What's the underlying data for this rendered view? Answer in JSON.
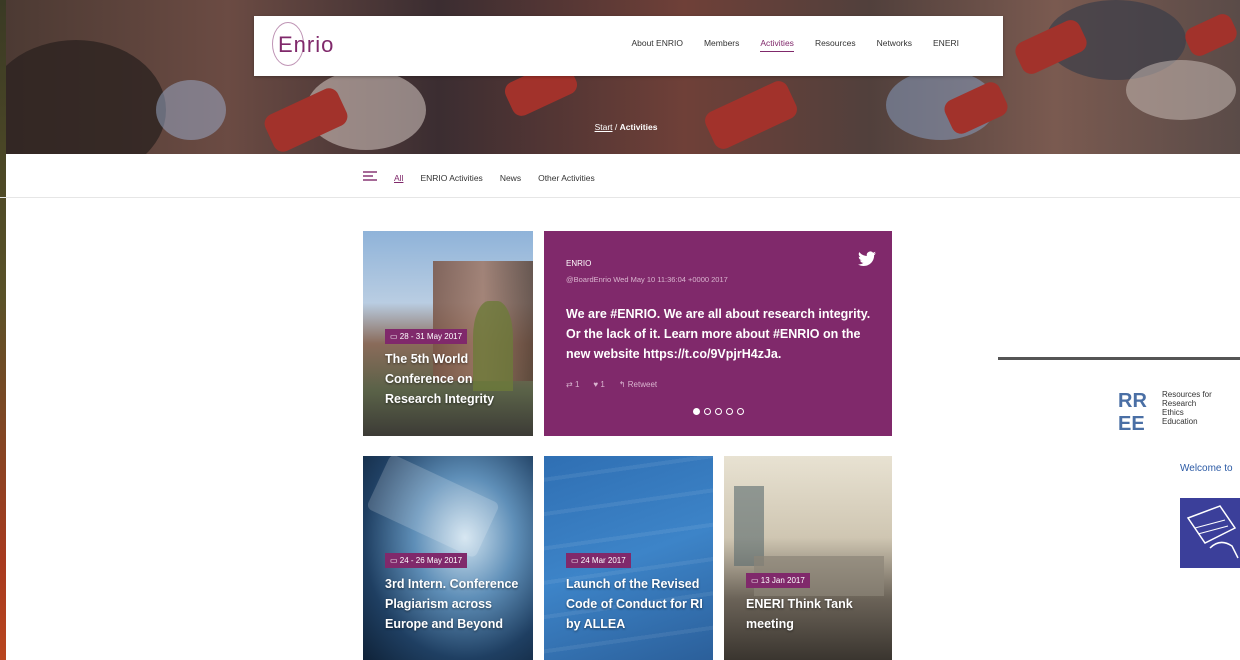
{
  "header": {
    "logo_text": "Enrio",
    "nav": [
      "About ENRIO",
      "Members",
      "Activities",
      "Resources",
      "Networks",
      "ENERI"
    ],
    "active_nav": "Activities"
  },
  "breadcrumb": {
    "start": "Start",
    "separator": "/",
    "current": "Activities"
  },
  "filters": {
    "items": [
      "All",
      "ENRIO Activities",
      "News",
      "Other Activities"
    ],
    "active": "All"
  },
  "cards": [
    {
      "date": "28 - 31 May 2017",
      "title": "The 5th World Conference on Research Integrity"
    },
    {
      "date": "24 - 26 May 2017",
      "title": "3rd Intern. Conference Plagiarism across Europe and Beyond"
    },
    {
      "date": "24 Mar 2017",
      "title": "Launch of the Revised Code of Conduct for RI by ALLEA"
    },
    {
      "date": "13 Jan 2017",
      "title": "ENERI Think Tank meeting"
    }
  ],
  "tweet": {
    "author": "ENRIO",
    "meta": "@BoardEnrio  Wed May 10 11:36:04 +0000 2017",
    "text": "We are #ENRIO. We are all about research integrity. Or the lack of it. Learn more about #ENRIO on the new website https://t.co/9VpjrH4zJa.",
    "retweets": "1",
    "likes": "1",
    "retweet_label": "Retweet",
    "pages": 5,
    "current_page": 1
  },
  "sidebar": {
    "rree_lines": [
      "Resources for",
      "Research",
      "Ethics",
      "Education"
    ],
    "welcome": "Welcome to"
  },
  "colors": {
    "accent": "#80296b",
    "link_blue": "#2b5aa5"
  }
}
